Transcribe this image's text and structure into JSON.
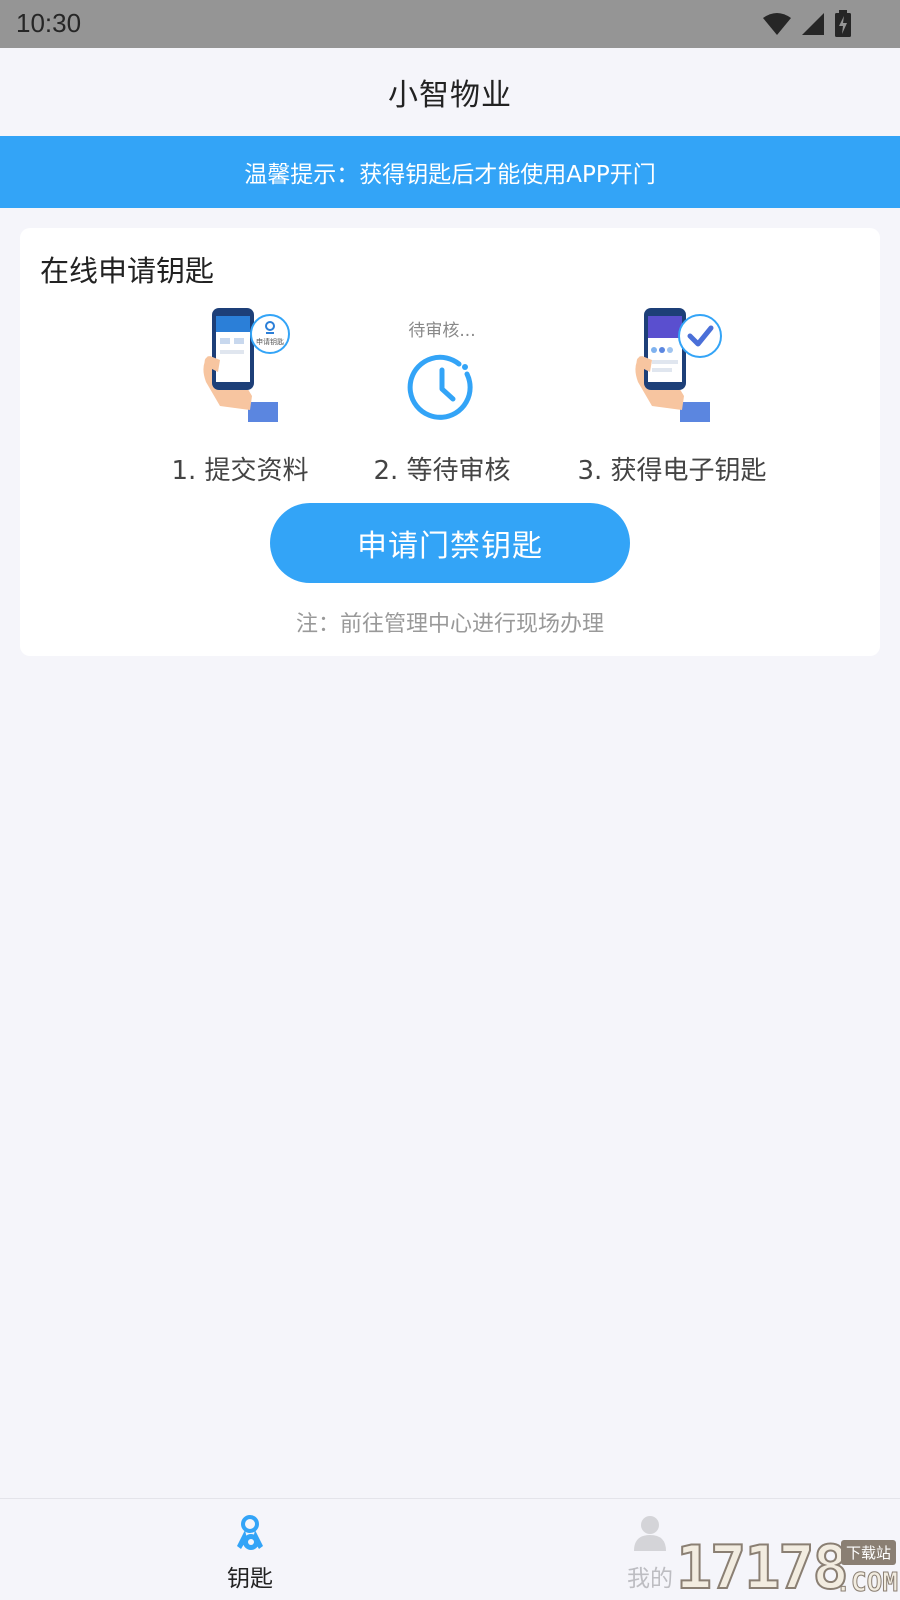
{
  "status_bar": {
    "time": "10:30",
    "icons": [
      "wifi-icon",
      "signal-icon",
      "battery-charging-icon"
    ]
  },
  "header": {
    "title": "小智物业"
  },
  "notice": {
    "text": "温馨提示：获得钥匙后才能使用APP开门"
  },
  "card": {
    "title": "在线申请钥匙",
    "steps": [
      {
        "label": "1. 提交资料",
        "illustration": "phone-apply-icon",
        "badge_text": "申请钥匙"
      },
      {
        "label": "2. 等待审核",
        "illustration": "clock-icon",
        "status_text": "待审核..."
      },
      {
        "label": "3. 获得电子钥匙",
        "illustration": "phone-check-icon"
      }
    ],
    "apply_button": "申请门禁钥匙",
    "note": "注：前往管理中心进行现场办理"
  },
  "tabbar": {
    "items": [
      {
        "label": "钥匙",
        "icon": "key-icon",
        "active": true
      },
      {
        "label": "我的",
        "icon": "person-icon",
        "active": false
      }
    ]
  },
  "watermark": {
    "digits": "17178",
    "suffix": ".COM",
    "tag": "下载站"
  },
  "colors": {
    "accent": "#33a4f7",
    "background": "#f5f5fa",
    "status_bar": "#959595"
  }
}
